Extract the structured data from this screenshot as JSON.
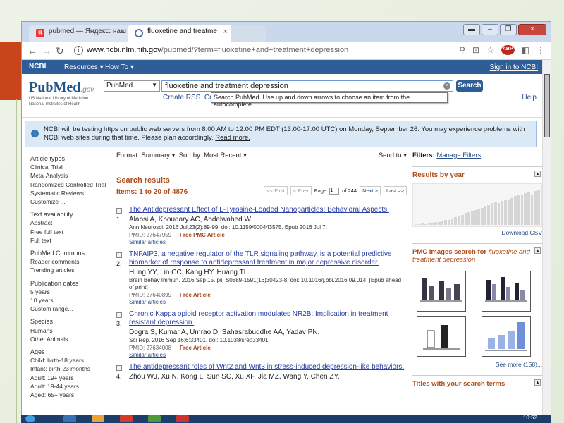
{
  "browser": {
    "tabs": [
      {
        "label": "pubmed — Яндекс: наш",
        "favicon": "yandex-icon"
      },
      {
        "label": "fluoxetine and treatme",
        "favicon": "pubmed-icon"
      },
      {
        "label": "",
        "favicon": ""
      }
    ],
    "url_host": "www.ncbi.nlm.nih.gov",
    "url_path": "/pubmed/?term=fluoxetine+and+treatment+depression",
    "abp_label": "ABP"
  },
  "ncbi": {
    "logo": "NCBI",
    "resources": "Resources ▾",
    "howto": "How To ▾",
    "signin": "Sign in to NCBI"
  },
  "pubmed_logo": {
    "pub": "Pub",
    "med": "Med",
    "gov": ".gov",
    "sub1": "US National Library of Medicine",
    "sub2": "National Institutes of Health"
  },
  "search": {
    "database": "PubMed",
    "query": "fluoxetine and treatment depression",
    "button": "Search",
    "create_rss": "Create RSS",
    "cr": "Cre",
    "tooltip": "Search PubMed. Use up and down arrows to choose an item from the autocomplete.",
    "help": "Help"
  },
  "notice": {
    "text": "NCBI will be testing https on public web servers from 8:00 AM to 12:00 PM EDT (13:00-17:00 UTC) on Monday, September 26. You may experience problems with NCBI web sites during that time. Please plan accordingly. ",
    "more": "Read more."
  },
  "sidebar": [
    {
      "heading": "Article types",
      "items": [
        "Clinical Trial",
        "Meta-Analysis",
        "Randomized Controlled Trial",
        "Systematic Reviews",
        "Customize ..."
      ]
    },
    {
      "heading": "Text availability",
      "items": [
        "Abstract",
        "Free full text",
        "Full text"
      ]
    },
    {
      "heading": "PubMed Commons",
      "items": [
        "Reader comments",
        "Trending articles"
      ]
    },
    {
      "heading": "Publication dates",
      "items": [
        "5 years",
        "10 years",
        "Custom range..."
      ]
    },
    {
      "heading": "Species",
      "items": [
        "Humans",
        "Other Animals"
      ]
    },
    {
      "heading": "Ages",
      "items": [
        "Child: birth-18 years",
        "Infant: birth-23 months",
        "Adult: 19+ years",
        "Adult: 19-44 years",
        "Aged: 65+ years"
      ]
    }
  ],
  "toolbar": {
    "format_label": "Format:",
    "format_value": "Summary ▾",
    "sort_label": "Sort by:",
    "sort_value": "Most Recent ▾",
    "send_to": "Send to ▾"
  },
  "results": {
    "heading": "Search results",
    "items_text": "Items: 1 to 20 of 4876",
    "pager": {
      "first": "<< First",
      "prev": "< Prev",
      "page_label": "Page",
      "page": "1",
      "of": "of 244",
      "next": "Next >",
      "last": "Last >>"
    },
    "list": [
      {
        "num": "1.",
        "title": "The Antidepressant Effect of L-Tyrosine-Loaded Nanoparticles: Behavioral Aspects.",
        "authors": "Alabsi A, Khoudary AC, Abdelwahed W.",
        "citation": "Ann Neurosci. 2016 Jul;23(2):89-99. doi: 10.1159/000443575. Epub 2016 Jul 7.",
        "pmid": "PMID: 27647959",
        "free": "Free PMC Article",
        "similar": "Similar articles"
      },
      {
        "num": "2.",
        "title": "TNFAIP3, a negative regulator of the TLR signaling pathway, is a potential predictive biomarker of response to antidepressant treatment in major depressive disorder.",
        "authors": "Hung YY, Lin CC, Kang HY, Huang TL.",
        "citation": "Brain Behav Immun. 2016 Sep 15. pii: S0889-1591(16)30423-8. doi: 10.1016/j.bbi.2016.09.014. [Epub ahead of print]",
        "pmid": "PMID: 27640899",
        "free": "Free Article",
        "similar": "Similar articles"
      },
      {
        "num": "3.",
        "title": "Chronic Kappa opioid receptor activation modulates NR2B: Implication in treatment resistant depression.",
        "authors": "Dogra S, Kumar A, Umrao D, Sahasrabuddhe AA, Yadav PN.",
        "citation": "Sci Rep. 2016 Sep 16;6:33401. doi: 10.1038/srep33401.",
        "pmid": "PMID: 27634008",
        "free": "Free Article",
        "similar": "Similar articles"
      },
      {
        "num": "4.",
        "title": "The antidepressant roles of Wnt2 and Wnt3 in stress-induced depression-like behaviors.",
        "authors": "Zhou WJ, Xu N, Kong L, Sun SC, Xu XF, Jia MZ, Wang Y, Chen ZY.",
        "citation": "",
        "pmid": "",
        "free": "",
        "similar": ""
      }
    ]
  },
  "right": {
    "filters_label": "Filters:",
    "manage_filters": "Manage Filters",
    "results_by_year": "Results by year",
    "year_counts": [
      1,
      1,
      2,
      1,
      2,
      2,
      3,
      3,
      4,
      5,
      5,
      6,
      8,
      9,
      10,
      12,
      13,
      14,
      15,
      16,
      17,
      19,
      20,
      22,
      23,
      22,
      24,
      26,
      25,
      27,
      29,
      30,
      30,
      32,
      33,
      31,
      34,
      35
    ],
    "year_max": 40,
    "download_csv": "Download CSV",
    "pmc_heading": "PMC Images search for ",
    "pmc_query": "fluoxetine and treatment depression",
    "see_more": "See more (158)...",
    "titles_heading": "Titles with your search terms"
  },
  "taskbar": {
    "clock": "10:52"
  }
}
